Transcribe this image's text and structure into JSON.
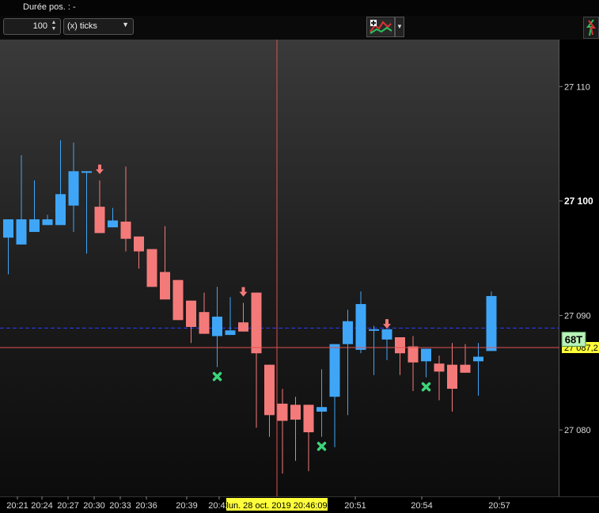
{
  "header": {
    "position_duration_label": "Durée pos. :  -"
  },
  "toolbar": {
    "quantity_value": "100",
    "unit_label": "(x) ticks",
    "tool_icon": "chart-tools-icon",
    "dropdown_icon": "chevron-down-icon",
    "corner_icon": "trade-arrows-icon"
  },
  "crosshair": {
    "time_label": "lun. 28 oct. 2019 20:46:09",
    "price_label": "27 087,2"
  },
  "countdown": {
    "label": "68T"
  },
  "colors": {
    "bull": "#3fa6f7",
    "bear": "#f47a7a",
    "crosshair": "#e05050",
    "reference_line": "#2c3cff",
    "highlight": "#ffff3a",
    "countdown_bg": "#b8f2b8"
  },
  "chart_data": {
    "type": "candlestick",
    "ylim": [
      27074.2,
      27114.1
    ],
    "y_ticks": [
      {
        "value": 27110,
        "label": "27 110",
        "bold": false
      },
      {
        "value": 27100,
        "label": "27 100",
        "bold": true
      },
      {
        "value": 27090,
        "label": "27 090",
        "bold": false
      },
      {
        "value": 27080,
        "label": "27 080",
        "bold": false
      }
    ],
    "x_ticks": [
      "20:21",
      "20:24",
      "20:27",
      "20:30",
      "20:33",
      "20:36",
      "20:39",
      "20:42",
      "20:51",
      "20:54",
      "20:57"
    ],
    "reference_price": 27088.9,
    "crosshair_price": 27087.2,
    "candles": [
      {
        "open": 27096.8,
        "high": 27098.2,
        "low": 27093.6,
        "close": 27098.4
      },
      {
        "open": 27096.2,
        "high": 27104.0,
        "low": 27096.7,
        "close": 27098.4
      },
      {
        "open": 27097.3,
        "high": 27101.8,
        "low": 27097.3,
        "close": 27098.4
      },
      {
        "open": 27097.9,
        "high": 27098.8,
        "low": 27097.9,
        "close": 27098.4
      },
      {
        "open": 27097.9,
        "high": 27105.3,
        "low": 27097.9,
        "close": 27100.6
      },
      {
        "open": 27099.6,
        "high": 27105.1,
        "low": 27097.3,
        "close": 27102.6
      },
      {
        "open": 27102.6,
        "high": 27102.6,
        "low": 27095.4,
        "close": 27102.6
      },
      {
        "open": 27099.5,
        "high": 27101.8,
        "low": 27098.1,
        "close": 27097.2
      },
      {
        "open": 27097.7,
        "high": 27099.4,
        "low": 27097.7,
        "close": 27098.3
      },
      {
        "open": 27098.2,
        "high": 27103.0,
        "low": 27095.6,
        "close": 27096.7
      },
      {
        "open": 27096.9,
        "high": 27096.9,
        "low": 27094.1,
        "close": 27095.6
      },
      {
        "open": 27095.8,
        "high": 27095.8,
        "low": 27094.9,
        "close": 27092.5
      },
      {
        "open": 27093.8,
        "high": 27097.8,
        "low": 27091.5,
        "close": 27091.4
      },
      {
        "open": 27093.1,
        "high": 27093.1,
        "low": 27091.6,
        "close": 27089.6
      },
      {
        "open": 27091.3,
        "high": 27091.3,
        "low": 27087.6,
        "close": 27089.0
      },
      {
        "open": 27090.3,
        "high": 27092.0,
        "low": 27088.4,
        "close": 27088.4
      },
      {
        "open": 27088.2,
        "high": 27092.5,
        "low": 27085.5,
        "close": 27089.9
      },
      {
        "open": 27088.3,
        "high": 27091.6,
        "low": 27090.0,
        "close": 27088.7
      },
      {
        "open": 27089.4,
        "high": 27091.1,
        "low": 27089.4,
        "close": 27088.6
      },
      {
        "open": 27092.0,
        "high": 27092.0,
        "low": 27080.2,
        "close": 27086.7
      },
      {
        "open": 27085.7,
        "high": 27085.7,
        "low": 27079.4,
        "close": 27081.3
      },
      {
        "open": 27082.3,
        "high": 27083.6,
        "low": 27076.2,
        "close": 27080.8
      },
      {
        "open": 27082.2,
        "high": 27082.9,
        "low": 27077.3,
        "close": 27080.9
      },
      {
        "open": 27082.2,
        "high": 27082.2,
        "low": 27076.4,
        "close": 27079.8
      },
      {
        "open": 27081.6,
        "high": 27085.3,
        "low": 27079.4,
        "close": 27082.0
      },
      {
        "open": 27082.9,
        "high": 27087.5,
        "low": 27078.5,
        "close": 27087.5
      },
      {
        "open": 27087.5,
        "high": 27090.5,
        "low": 27081.3,
        "close": 27089.5
      },
      {
        "open": 27087.0,
        "high": 27092.1,
        "low": 27086.7,
        "close": 27091.0
      },
      {
        "open": 27088.8,
        "high": 27089.1,
        "low": 27084.8,
        "close": 27088.8
      },
      {
        "open": 27087.9,
        "high": 27088.3,
        "low": 27086.1,
        "close": 27088.8
      },
      {
        "open": 27088.1,
        "high": 27088.1,
        "low": 27084.8,
        "close": 27086.7
      },
      {
        "open": 27087.3,
        "high": 27088.2,
        "low": 27083.4,
        "close": 27085.9
      },
      {
        "open": 27086.0,
        "high": 27086.1,
        "low": 27084.6,
        "close": 27087.1
      },
      {
        "open": 27085.8,
        "high": 27086.5,
        "low": 27082.6,
        "close": 27085.1
      },
      {
        "open": 27085.7,
        "high": 27087.6,
        "low": 27081.6,
        "close": 27083.6
      },
      {
        "open": 27085.7,
        "high": 27087.5,
        "low": 27085.6,
        "close": 27085.0
      },
      {
        "open": 27086.0,
        "high": 27087.6,
        "low": 27083.0,
        "close": 27086.4
      },
      {
        "open": 27086.9,
        "high": 27092.1,
        "low": 27086.9,
        "close": 27091.7
      }
    ],
    "markers": [
      {
        "type": "sell-arrow",
        "candle": 7
      },
      {
        "type": "sell-arrow",
        "candle": 18
      },
      {
        "type": "sell-arrow",
        "candle": 29
      },
      {
        "type": "cross",
        "candle": 16
      },
      {
        "type": "cross",
        "candle": 24
      },
      {
        "type": "cross",
        "candle": 32
      }
    ]
  }
}
